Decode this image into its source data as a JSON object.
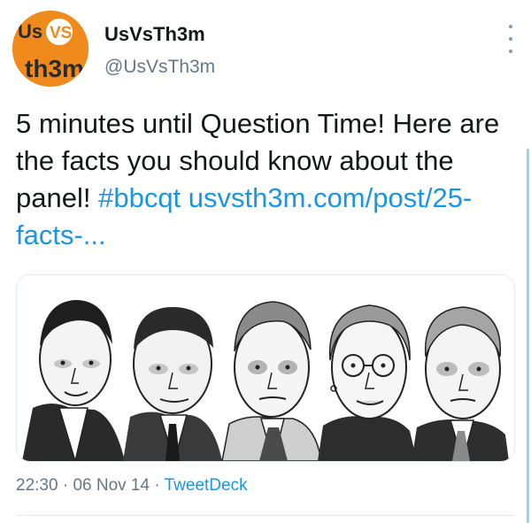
{
  "tweet": {
    "author": {
      "name": "UsVsTh3m",
      "handle": "@UsVsTh3m",
      "avatar_text": {
        "top": "Us",
        "vs": "VS",
        "bottom": "th3m"
      }
    },
    "text_plain": "5 minutes until Question Time! Here are the facts you should know about the panel!",
    "hashtag": "#bbcqt",
    "link": "usvsth3m.com/post/25-facts-...",
    "media_alt": "Cartoon caricatures of five panelists",
    "meta": {
      "time": "22:30",
      "sep1": "·",
      "date": "06 Nov 14",
      "sep2": "·",
      "source": "TweetDeck"
    }
  },
  "icons": {
    "more": "more-vertical-icon"
  },
  "colors": {
    "link": "#1b95e0",
    "secondary_text": "#657786",
    "avatar_bg": "#f18a1c",
    "border": "#e1e8ed"
  }
}
